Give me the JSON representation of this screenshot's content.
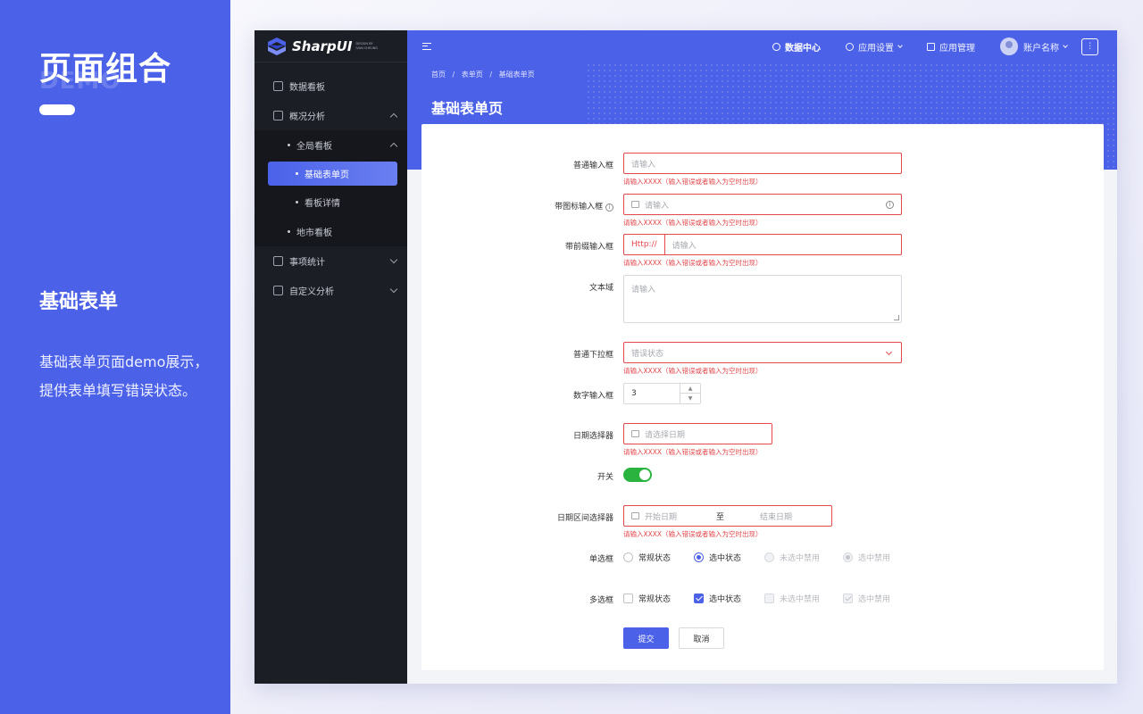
{
  "intro": {
    "title": "页面组合",
    "ghost": "DEMO",
    "subtitle": "基础表单",
    "description": "基础表单页面demo展示，提供表单填写错误状态。"
  },
  "brand": {
    "name": "SharpUI",
    "tag": "DESIGN BY IVAN CHEUNG"
  },
  "sidebar": {
    "items": [
      {
        "label": "数据看板",
        "icon": "dashboard-icon"
      },
      {
        "label": "概况分析",
        "icon": "chart-icon"
      },
      {
        "label": "全局看板"
      },
      {
        "label": "基础表单页"
      },
      {
        "label": "看板详情"
      },
      {
        "label": "地市看板"
      },
      {
        "label": "事项统计",
        "icon": "list-icon"
      },
      {
        "label": "自定义分析",
        "icon": "custom-icon"
      }
    ]
  },
  "topbar": {
    "data_center": "数据中心",
    "app_settings": "应用设置",
    "app_manage": "应用管理",
    "account": "账户名称"
  },
  "breadcrumb": [
    "首页",
    "/",
    "表单页",
    "/",
    "基础表单页"
  ],
  "page_title": "基础表单页",
  "form": {
    "error_text": "请输入XXXX（输入错误或者输入为空时出现）",
    "normal_input": {
      "label": "普通输入框",
      "placeholder": "请输入"
    },
    "icon_input": {
      "label": "带图标输入框",
      "placeholder": "请输入"
    },
    "prefix_input": {
      "label": "带前缀输入框",
      "prefix": "Http://",
      "placeholder": "请输入"
    },
    "textarea": {
      "label": "文本域",
      "placeholder": "请输入"
    },
    "select": {
      "label": "普通下拉框",
      "placeholder": "错误状态"
    },
    "number": {
      "label": "数字输入框",
      "value": "3"
    },
    "date": {
      "label": "日期选择器",
      "placeholder": "请选择日期"
    },
    "switch": {
      "label": "开关",
      "on": true
    },
    "date_range": {
      "label": "日期区间选择器",
      "start": "开始日期",
      "sep": "至",
      "end": "结束日期"
    },
    "radio": {
      "label": "单选框",
      "options": [
        "常规状态",
        "选中状态",
        "未选中禁用",
        "选中禁用"
      ]
    },
    "checkbox": {
      "label": "多选框",
      "options": [
        "常规状态",
        "选中状态",
        "未选中禁用",
        "选中禁用"
      ]
    },
    "submit": "提交",
    "cancel": "取消"
  },
  "colors": {
    "brand": "#4b61e8",
    "error": "#e3484c",
    "success": "#2bb33f",
    "sidebar": "#1c1e25"
  }
}
